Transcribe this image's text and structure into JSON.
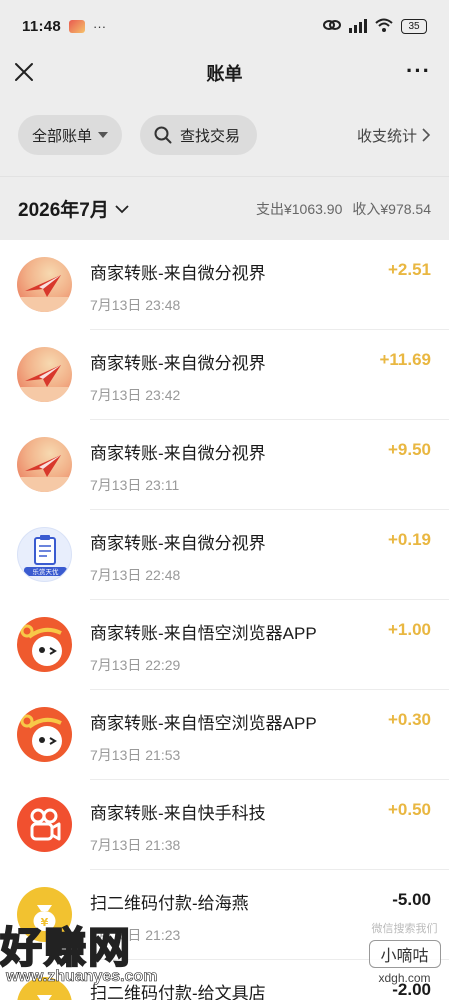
{
  "status_bar": {
    "time": "11:48",
    "dots": "···",
    "battery": "35"
  },
  "nav": {
    "title": "账单"
  },
  "filters": {
    "all_bills": "全部账单",
    "search": "查找交易",
    "stats": "收支统计"
  },
  "month_header": {
    "month": "2026年7月",
    "expense": "支出¥1063.90",
    "income": "收入¥978.54"
  },
  "transactions": [
    {
      "name": "商家转账-来自微分视界",
      "time": "7月13日 23:48",
      "amount": "+2.51",
      "icon": "paper-plane-icon"
    },
    {
      "name": "商家转账-来自微分视界",
      "time": "7月13日 23:42",
      "amount": "+11.69",
      "icon": "paper-plane-icon"
    },
    {
      "name": "商家转账-来自微分视界",
      "time": "7月13日 23:11",
      "amount": "+9.50",
      "icon": "paper-plane-icon"
    },
    {
      "name": "商家转账-来自微分视界",
      "time": "7月13日 22:48",
      "amount": "+0.19",
      "icon": "document-icon",
      "icon_text": "乐赏天优"
    },
    {
      "name": "商家转账-来自悟空浏览器APP",
      "time": "7月13日 22:29",
      "amount": "+1.00",
      "icon": "wukong-icon"
    },
    {
      "name": "商家转账-来自悟空浏览器APP",
      "time": "7月13日 21:53",
      "amount": "+0.30",
      "icon": "wukong-icon"
    },
    {
      "name": "商家转账-来自快手科技",
      "time": "7月13日 21:38",
      "amount": "+0.50",
      "icon": "kuaishou-icon"
    },
    {
      "name": "扫二维码付款-给海燕",
      "time": "7月13日 21:23",
      "amount": "-5.00",
      "icon": "money-bag-icon"
    },
    {
      "name": "扫二维码付款-给文具店",
      "time": "",
      "amount": "-2.00",
      "icon": "money-bag-icon"
    }
  ],
  "watermarks": {
    "big": "好赚网",
    "url": "www.zhuanyes.com",
    "small_top": "微信搜索我们",
    "small_box": "小嘀咕",
    "small_domain": "xdgh.com"
  },
  "colors": {
    "income": "#e9b741",
    "background_gray": "#ededed"
  }
}
